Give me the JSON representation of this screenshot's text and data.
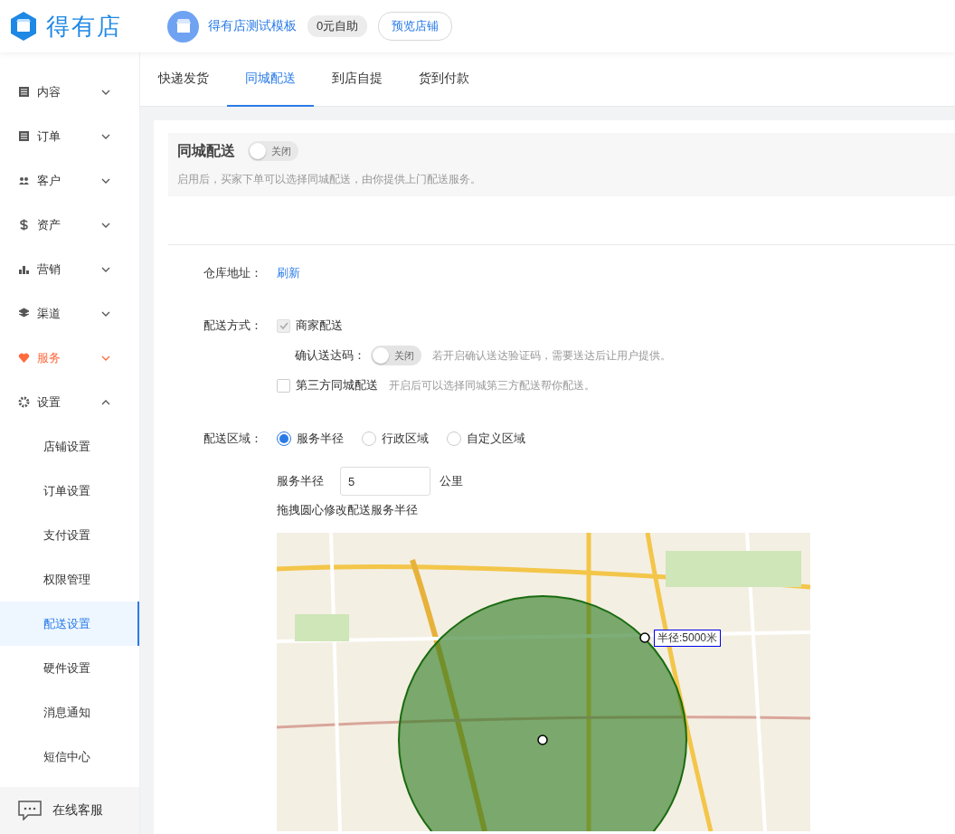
{
  "header": {
    "logo": "得有店",
    "shop_name": "得有店测试模板",
    "plan_badge": "0元自助",
    "preview_button": "预览店铺"
  },
  "sidebar": {
    "items": [
      {
        "label": "内容",
        "expanded": false,
        "highlighted": false
      },
      {
        "label": "订单",
        "expanded": false,
        "highlighted": false
      },
      {
        "label": "客户",
        "expanded": false,
        "highlighted": false
      },
      {
        "label": "资产",
        "expanded": false,
        "highlighted": false
      },
      {
        "label": "营销",
        "expanded": false,
        "highlighted": false
      },
      {
        "label": "渠道",
        "expanded": false,
        "highlighted": false
      },
      {
        "label": "服务",
        "expanded": false,
        "highlighted": true
      },
      {
        "label": "设置",
        "expanded": true,
        "highlighted": false,
        "children": [
          {
            "label": "店铺设置",
            "selected": false
          },
          {
            "label": "订单设置",
            "selected": false
          },
          {
            "label": "支付设置",
            "selected": false
          },
          {
            "label": "权限管理",
            "selected": false
          },
          {
            "label": "配送设置",
            "selected": true
          },
          {
            "label": "硬件设置",
            "selected": false
          },
          {
            "label": "消息通知",
            "selected": false
          },
          {
            "label": "短信中心",
            "selected": false
          }
        ]
      }
    ],
    "support": "在线客服"
  },
  "tabs": [
    {
      "label": "快递发货",
      "selected": false
    },
    {
      "label": "同城配送",
      "selected": true
    },
    {
      "label": "到店自提",
      "selected": false
    },
    {
      "label": "货到付款",
      "selected": false
    }
  ],
  "section": {
    "title": "同城配送",
    "toggle": {
      "on": false,
      "label": "关闭"
    },
    "description": "启用后，买家下单可以选择同城配送，由你提供上门配送服务。"
  },
  "form": {
    "warehouse": {
      "label": "仓库地址：",
      "link": "刷新"
    },
    "method": {
      "label": "配送方式：",
      "merchant": {
        "label": "商家配送",
        "checked": true,
        "disabled": true
      },
      "confirm_code": {
        "label": "确认送达码：",
        "toggle": {
          "on": false,
          "label": "关闭"
        },
        "hint": "若开启确认送达验证码，需要送达后让用户提供。"
      },
      "third_party": {
        "label": "第三方同城配送",
        "checked": false,
        "disabled": false,
        "hint": "开启后可以选择同城第三方配送帮你配送。"
      }
    },
    "area": {
      "label": "配送区域：",
      "options": [
        {
          "label": "服务半径",
          "selected": true
        },
        {
          "label": "行政区域",
          "selected": false
        },
        {
          "label": "自定义区域",
          "selected": false
        }
      ],
      "radius": {
        "label": "服务半径",
        "value": "5",
        "unit": "公里"
      },
      "hint": "拖拽圆心修改配送服务半径",
      "map": {
        "radius_label": "半径:5000米"
      }
    }
  }
}
